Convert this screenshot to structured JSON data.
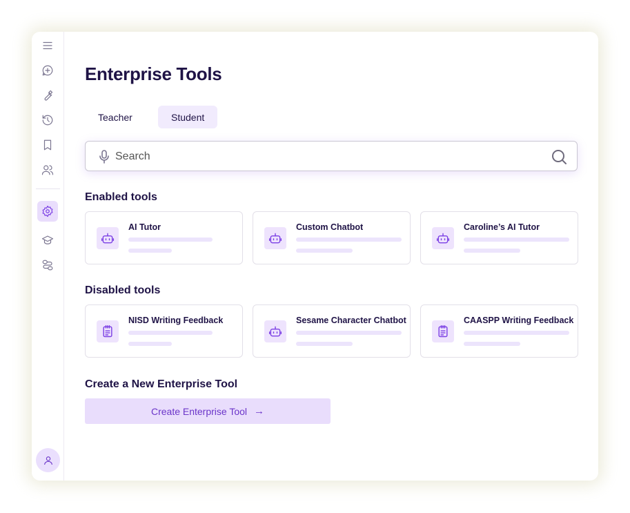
{
  "page_title": "Enterprise Tools",
  "tabs": [
    {
      "label": "Teacher",
      "selected": false
    },
    {
      "label": "Student",
      "selected": true
    }
  ],
  "search": {
    "placeholder": "Search",
    "value": ""
  },
  "sections": {
    "enabled_title": "Enabled tools",
    "disabled_title": "Disabled tools",
    "create_title": "Create a New Enterprise Tool"
  },
  "enabled_tools": [
    {
      "name": "AI Tutor",
      "icon": "robot-icon"
    },
    {
      "name": "Custom Chatbot",
      "icon": "robot-icon"
    },
    {
      "name": "Caroline’s AI Tutor",
      "icon": "robot-icon"
    }
  ],
  "disabled_tools": [
    {
      "name": "NISD Writing Feedback",
      "icon": "clipboard-icon"
    },
    {
      "name": "Sesame Character Chatbot",
      "icon": "robot-icon"
    },
    {
      "name": "CAASPP Writing Feedback",
      "icon": "clipboard-icon"
    }
  ],
  "create_button": {
    "label": "Create Enterprise Tool",
    "icon": "arrow-right-icon"
  },
  "sidebar_icons": [
    "menu-icon",
    "new-chat-icon",
    "wrench-icon",
    "history-icon",
    "bookmark-icon",
    "users-icon",
    "settings-icon",
    "graduation-cap-icon",
    "workflow-icon",
    "user-icon"
  ],
  "colors": {
    "accent": "#7b3fe4",
    "accent_light": "#e9ddfc",
    "title": "#1f1346"
  }
}
